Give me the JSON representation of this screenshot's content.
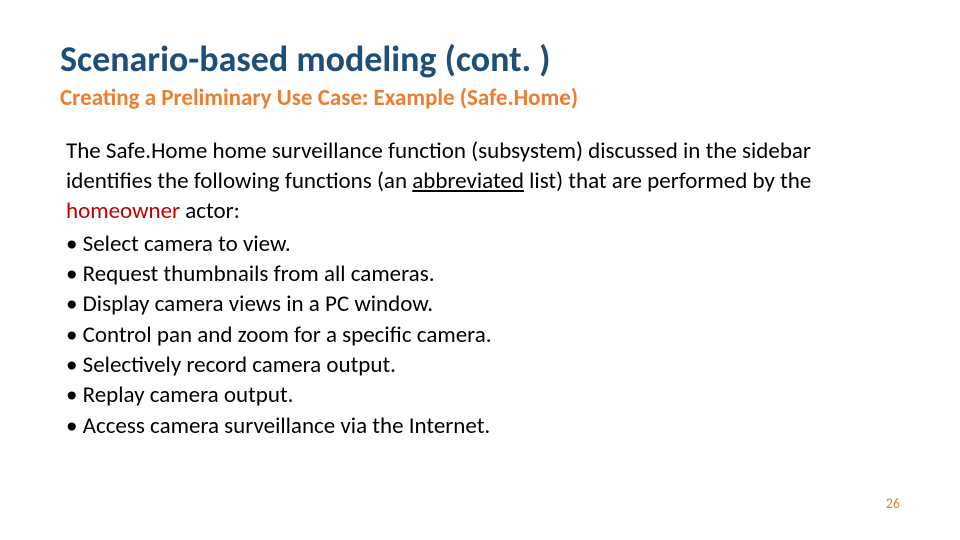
{
  "title": "Scenario-based modeling (cont. )",
  "subtitle": "Creating a Preliminary Use Case: Example (Safe.Home)",
  "intro": {
    "part1": "The Safe.Home home surveillance function (subsystem) discussed in the sidebar identifies the following functions (an ",
    "abbrev": "abbreviated",
    "part2": " list) that are performed by the ",
    "actor": "homeowner",
    "part3": " actor:"
  },
  "bullets": [
    "Select camera to view.",
    "Request thumbnails from all cameras.",
    "Display camera views in a PC window.",
    "Control pan and zoom for a specific camera.",
    "Selectively record camera output.",
    "Replay camera output.",
    "Access camera surveillance via the Internet."
  ],
  "page_number": "26"
}
